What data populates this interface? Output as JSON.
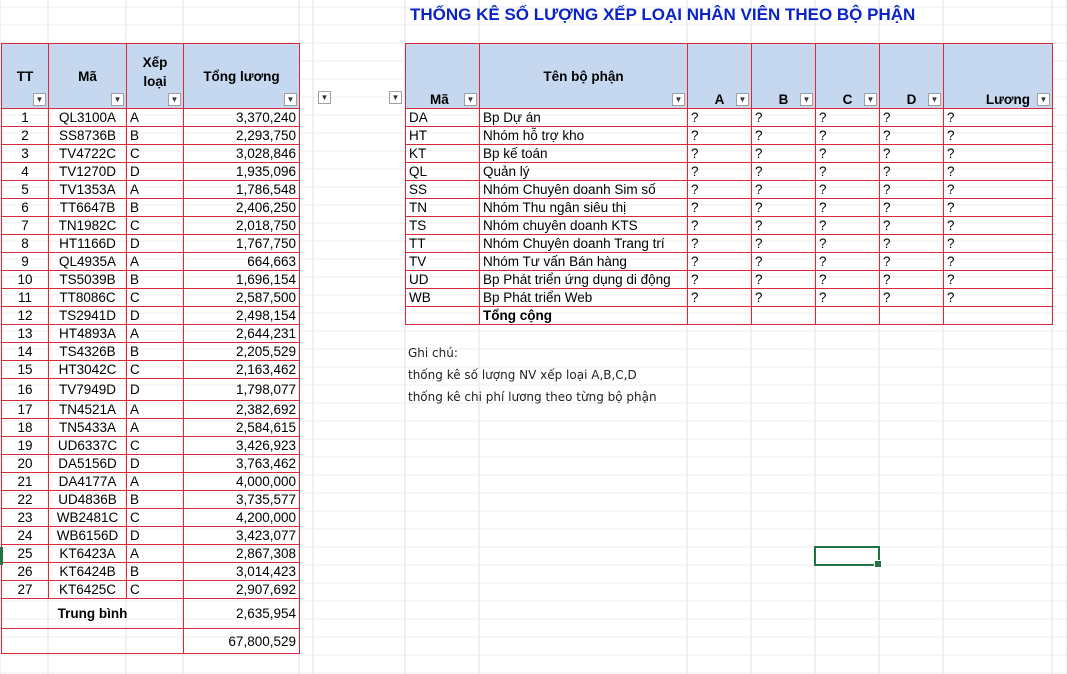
{
  "title": "THỐNG KÊ SỐ LƯỢNG XẾP LOẠI NHÂN VIÊN THEO BỘ PHẬN",
  "left_table": {
    "headers": {
      "tt": "TT",
      "ma": "Mã",
      "xep_loai_1": "Xếp",
      "xep_loai_2": "loại",
      "tong_luong": "Tổng lương"
    },
    "rows": [
      {
        "tt": "1",
        "ma": "QL3100A",
        "xl": "A",
        "luong": "3,370,240"
      },
      {
        "tt": "2",
        "ma": "SS8736B",
        "xl": "B",
        "luong": "2,293,750"
      },
      {
        "tt": "3",
        "ma": "TV4722C",
        "xl": "C",
        "luong": "3,028,846"
      },
      {
        "tt": "4",
        "ma": "TV1270D",
        "xl": "D",
        "luong": "1,935,096"
      },
      {
        "tt": "5",
        "ma": "TV1353A",
        "xl": "A",
        "luong": "1,786,548"
      },
      {
        "tt": "6",
        "ma": "TT6647B",
        "xl": "B",
        "luong": "2,406,250"
      },
      {
        "tt": "7",
        "ma": "TN1982C",
        "xl": "C",
        "luong": "2,018,750"
      },
      {
        "tt": "8",
        "ma": "HT1166D",
        "xl": "D",
        "luong": "1,767,750"
      },
      {
        "tt": "9",
        "ma": "QL4935A",
        "xl": "A",
        "luong": "664,663"
      },
      {
        "tt": "10",
        "ma": "TS5039B",
        "xl": "B",
        "luong": "1,696,154"
      },
      {
        "tt": "11",
        "ma": "TT8086C",
        "xl": "C",
        "luong": "2,587,500"
      },
      {
        "tt": "12",
        "ma": "TS2941D",
        "xl": "D",
        "luong": "2,498,154"
      },
      {
        "tt": "13",
        "ma": "HT4893A",
        "xl": "A",
        "luong": "2,644,231"
      },
      {
        "tt": "14",
        "ma": "TS4326B",
        "xl": "B",
        "luong": "2,205,529"
      },
      {
        "tt": "15",
        "ma": "HT3042C",
        "xl": "C",
        "luong": "2,163,462"
      },
      {
        "tt": "16",
        "ma": "TV7949D",
        "xl": "D",
        "luong": "1,798,077"
      },
      {
        "tt": "17",
        "ma": "TN4521A",
        "xl": "A",
        "luong": "2,382,692"
      },
      {
        "tt": "18",
        "ma": "TN5433A",
        "xl": "A",
        "luong": "2,584,615"
      },
      {
        "tt": "19",
        "ma": "UD6337C",
        "xl": "C",
        "luong": "3,426,923"
      },
      {
        "tt": "20",
        "ma": "DA5156D",
        "xl": "D",
        "luong": "3,763,462"
      },
      {
        "tt": "21",
        "ma": "DA4177A",
        "xl": "A",
        "luong": "4,000,000"
      },
      {
        "tt": "22",
        "ma": "UD4836B",
        "xl": "B",
        "luong": "3,735,577"
      },
      {
        "tt": "23",
        "ma": "WB2481C",
        "xl": "C",
        "luong": "4,200,000"
      },
      {
        "tt": "24",
        "ma": "WB6156D",
        "xl": "D",
        "luong": "3,423,077"
      },
      {
        "tt": "25",
        "ma": "KT6423A",
        "xl": "A",
        "luong": "2,867,308"
      },
      {
        "tt": "26",
        "ma": "KT6424B",
        "xl": "B",
        "luong": "3,014,423"
      },
      {
        "tt": "27",
        "ma": "KT6425C",
        "xl": "C",
        "luong": "2,907,692"
      }
    ],
    "average_label": "Trung bình",
    "average_value": "2,635,954",
    "total_value": "67,800,529"
  },
  "right_table": {
    "headers": {
      "ma": "Mã",
      "ten": "Tên bộ phận",
      "a": "A",
      "b": "B",
      "c": "C",
      "d": "D",
      "luong": "Lương"
    },
    "rows": [
      {
        "ma": "DA",
        "ten": "Bp Dự án",
        "v": "?"
      },
      {
        "ma": "HT",
        "ten": "Nhóm hỗ trợ kho",
        "v": "?"
      },
      {
        "ma": "KT",
        "ten": "Bp kế toán",
        "v": "?"
      },
      {
        "ma": "QL",
        "ten": "Quản lý",
        "v": "?"
      },
      {
        "ma": "SS",
        "ten": "Nhóm Chuyên doanh Sim số",
        "v": "?"
      },
      {
        "ma": "TN",
        "ten": "Nhóm Thu ngân siêu thị",
        "v": "?"
      },
      {
        "ma": "TS",
        "ten": "Nhóm chuyên doanh KTS",
        "v": "?"
      },
      {
        "ma": "TT",
        "ten": "Nhóm Chuyên doanh Trang trí",
        "v": "?"
      },
      {
        "ma": "TV",
        "ten": "Nhóm Tư vấn Bán hàng",
        "v": "?"
      },
      {
        "ma": "UD",
        "ten": "Bp Phát triển ứng dụng di động",
        "v": "?"
      },
      {
        "ma": "WB",
        "ten": "Bp Phát triển Web",
        "v": "?"
      }
    ],
    "total_label": "Tổng cộng"
  },
  "notes": {
    "heading": "Ghi chú:",
    "line1": "thống kê số lượng NV xếp loại A,B,C,D",
    "line2": "thống kê chi phí lương theo từng bộ phận"
  },
  "icons": {
    "filter": "filter-dropdown-icon"
  },
  "colors": {
    "title": "#0a23c7",
    "header_fill": "#c6d8ef",
    "border": "#d8283a",
    "selection": "#217346"
  }
}
